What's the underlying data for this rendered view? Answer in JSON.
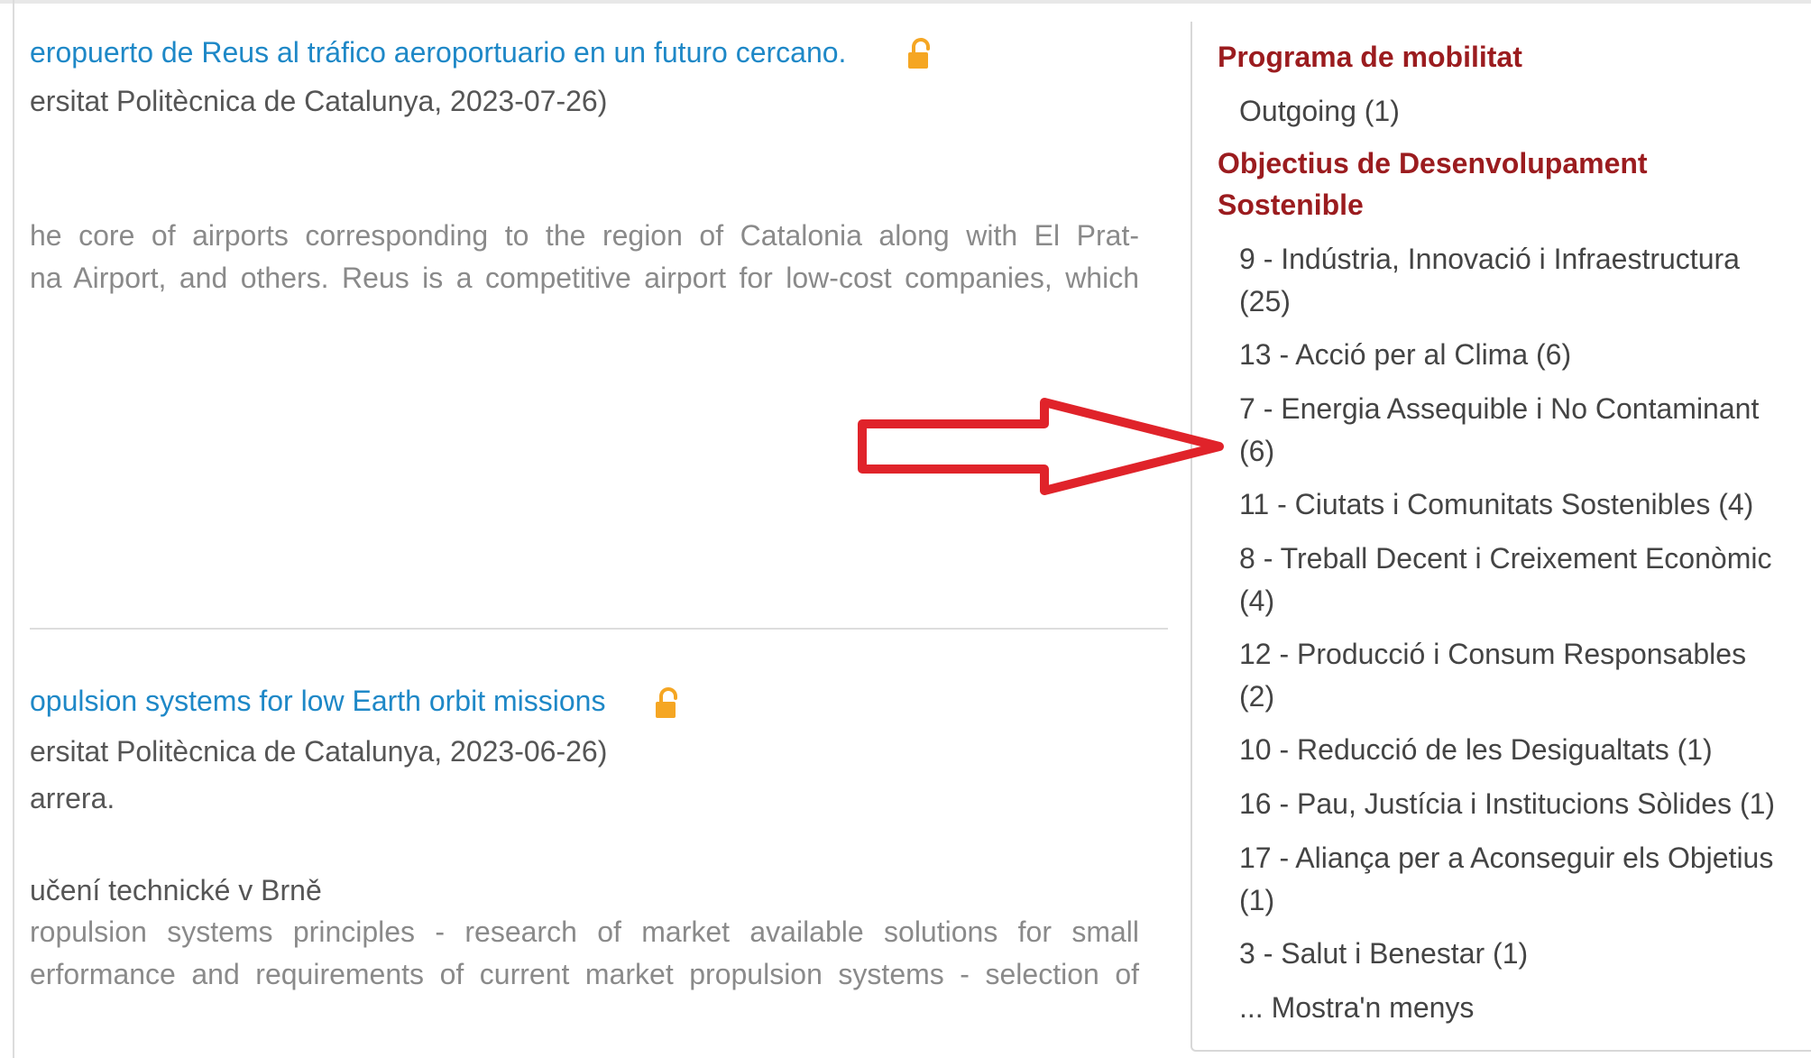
{
  "results": [
    {
      "title": "eropuerto de Reus al tráfico aeroportuario en un futuro cercano.",
      "meta": "ersitat Politècnica de Catalunya, 2023-07-26)",
      "abstract_lines": [
        "he core of airports corresponding to the region of Catalonia along with El Prat-",
        "na Airport, and others. Reus is a competitive airport for low-cost companies, which"
      ]
    },
    {
      "title": "opulsion systems for low Earth orbit missions",
      "meta": "ersitat Politècnica de Catalunya, 2023-06-26)",
      "meta2": "arrera.",
      "institution": "učení technické v Brně",
      "abstract_lines": [
        "ropulsion systems principles - research of market available solutions for small",
        "erformance and requirements of current market propulsion systems - selection of"
      ]
    }
  ],
  "facets": {
    "mobility_heading": "Programa de mobilitat",
    "mobility_items": [
      "Outgoing (1)"
    ],
    "ods_heading_line1": "Objectius de Desenvolupament",
    "ods_heading_line2": "Sostenible",
    "ods_items": [
      {
        "line1": "9 - Indústria, Innovació i Infraestructura",
        "line2": "(25)"
      },
      {
        "line1": "13 - Acció per al Clima (6)"
      },
      {
        "line1": "7 - Energia Assequible i No Contaminant",
        "line2": "(6)"
      },
      {
        "line1": "11 - Ciutats i Comunitats Sostenibles (4)"
      },
      {
        "line1": "8 - Treball Decent i Creixement Econòmic",
        "line2": "(4)"
      },
      {
        "line1": "12 - Producció i Consum Responsables",
        "line2": "(2)"
      },
      {
        "line1": "10 - Reducció de les Desigualtats (1)"
      },
      {
        "line1": "16 - Pau, Justícia i Institucions Sòlides (1)"
      },
      {
        "line1": "17 - Aliança per a Aconseguir els Objetius",
        "line2": "(1)"
      },
      {
        "line1": "3 - Salut i Benestar (1)"
      }
    ],
    "show_less": "... Mostra'n menys"
  },
  "colors": {
    "link": "#1e88c7",
    "facet_heading": "#9b1c1f",
    "annotation_arrow": "#e0232a",
    "open_access_icon": "#f5a623"
  },
  "icons": {
    "open_access": "open-lock-icon",
    "annotation": "right-arrow-icon"
  }
}
